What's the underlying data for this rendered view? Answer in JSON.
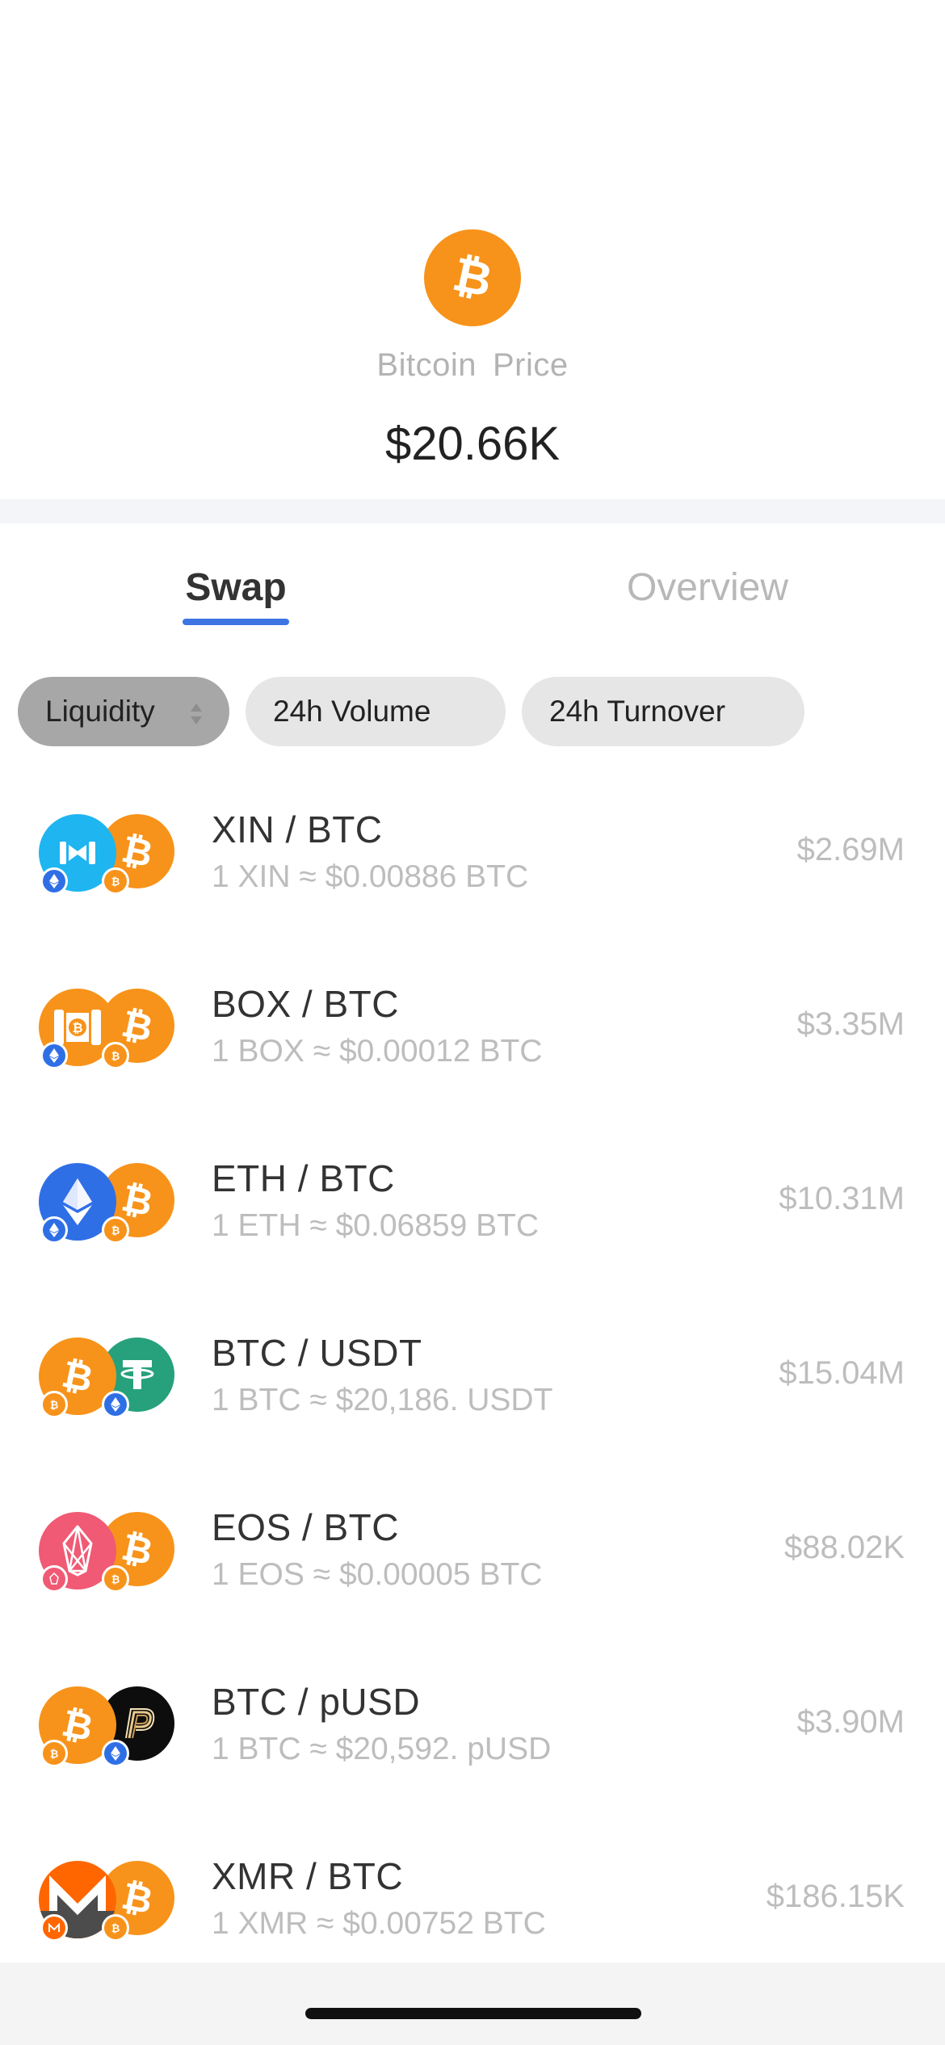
{
  "coin": {
    "name": "Bitcoin",
    "label": "Price",
    "price": "$20.66K",
    "icon": "bitcoin-icon",
    "color": "#f7931a"
  },
  "tabs": [
    {
      "label": "Swap",
      "active": true
    },
    {
      "label": "Overview",
      "active": false
    }
  ],
  "sort_chips": [
    {
      "label": "Liquidity",
      "active": true
    },
    {
      "label": "24h Volume",
      "active": false
    },
    {
      "label": "24h Turnover",
      "active": false
    }
  ],
  "pairs": [
    {
      "name": "XIN / BTC",
      "rate": "1 XIN ≈ $0.00886 BTC",
      "value": "$2.69M"
    },
    {
      "name": "BOX / BTC",
      "rate": "1 BOX ≈ $0.00012 BTC",
      "value": "$3.35M"
    },
    {
      "name": "ETH / BTC",
      "rate": "1 ETH ≈ $0.06859 BTC",
      "value": "$10.31M"
    },
    {
      "name": "BTC / USDT",
      "rate": "1 BTC ≈ $20,186. USDT",
      "value": "$15.04M"
    },
    {
      "name": "EOS / BTC",
      "rate": "1 EOS ≈ $0.00005 BTC",
      "value": "$88.02K"
    },
    {
      "name": "BTC / pUSD",
      "rate": "1 BTC ≈ $20,592. pUSD",
      "value": "$3.90M"
    },
    {
      "name": "XMR / BTC",
      "rate": "1 XMR ≈ $0.00752 BTC",
      "value": "$186.15K"
    }
  ],
  "colors": {
    "accent": "#3d75e3",
    "bitcoin": "#f7931a",
    "xin": "#1eb5f0",
    "eth": "#2f6fe6",
    "usdt": "#26a17b",
    "eos": "#f05a74",
    "xmr": "#ff6600"
  }
}
